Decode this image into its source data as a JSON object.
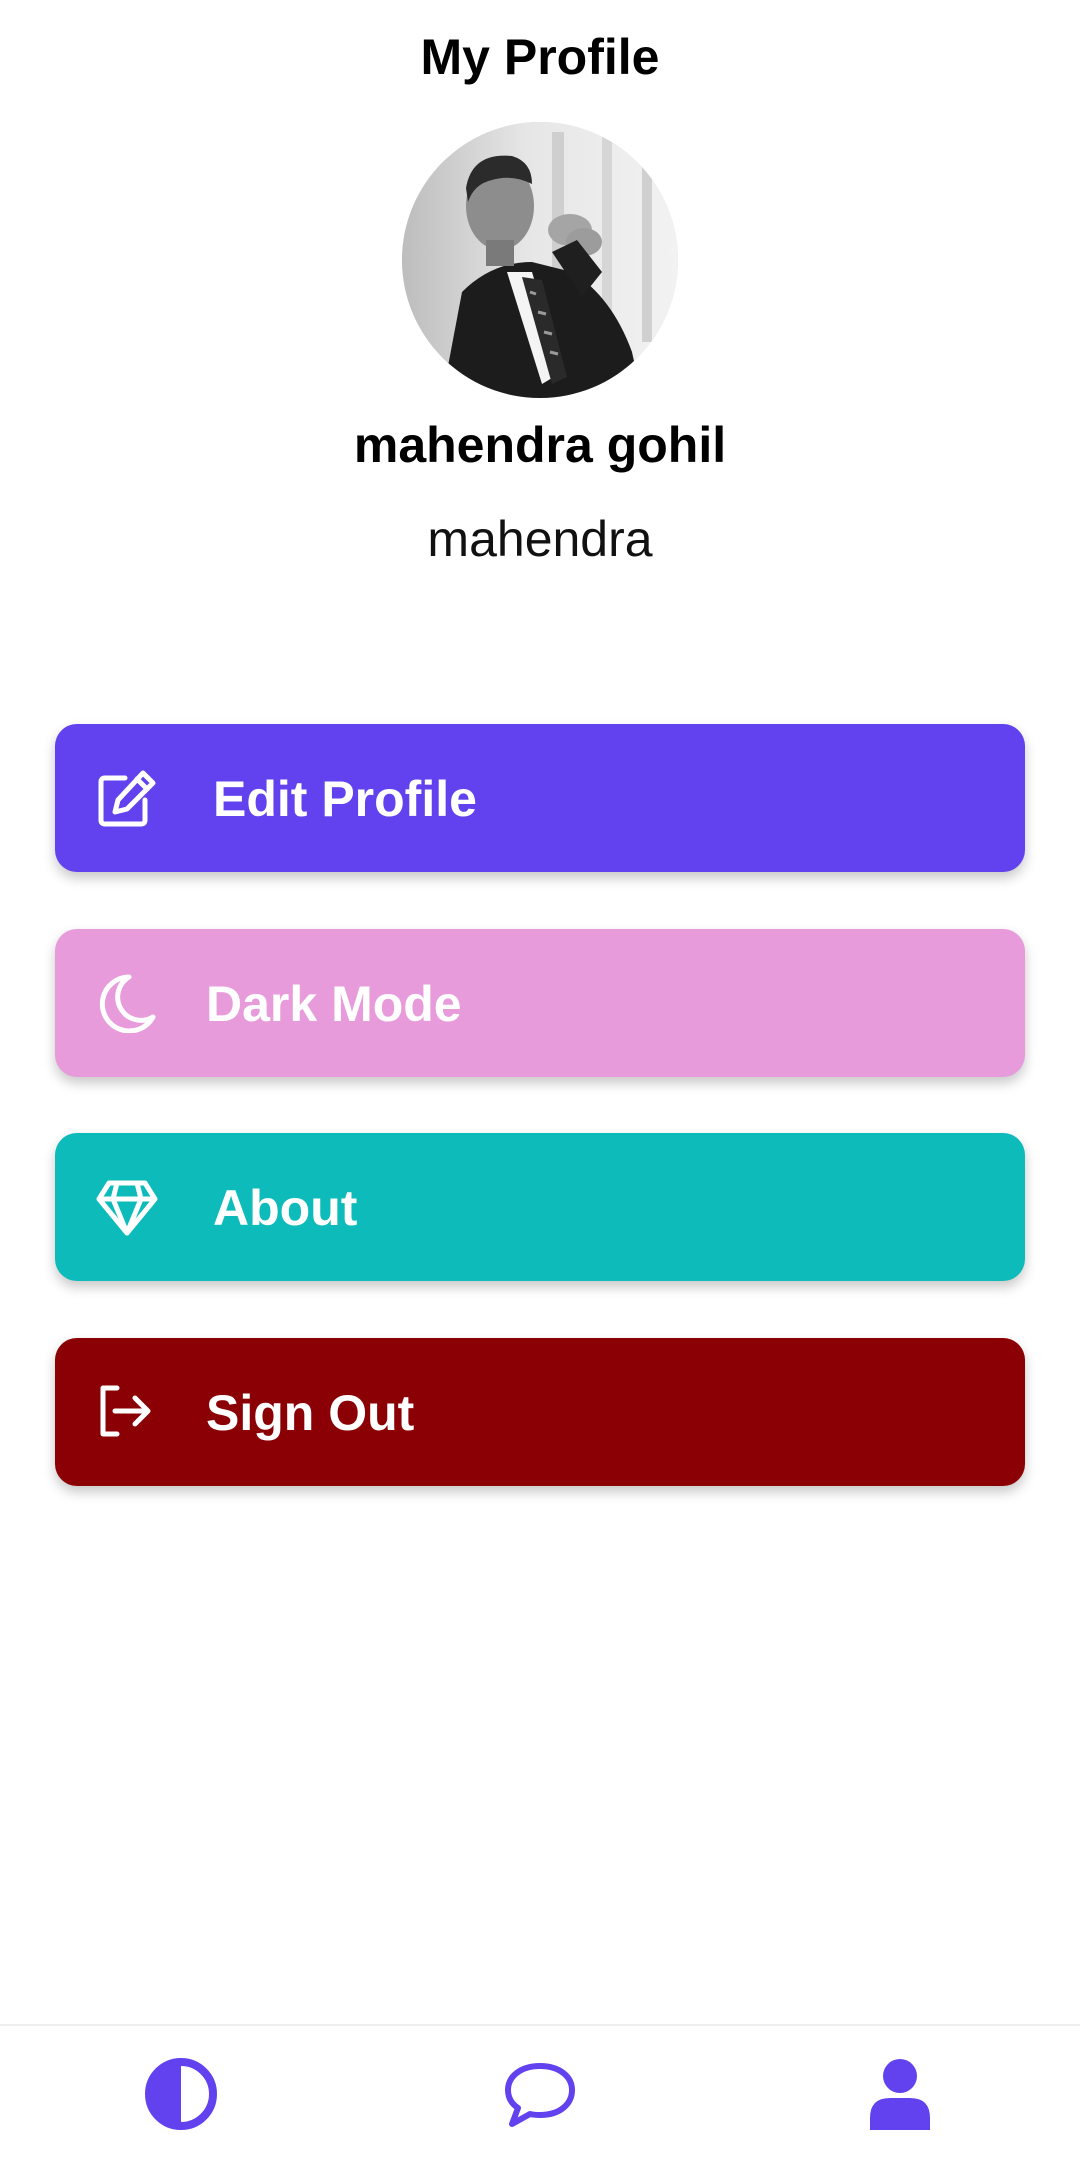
{
  "header": {
    "title": "My Profile"
  },
  "profile": {
    "avatar_icon": "profile-photo",
    "display_name": "mahendra gohil",
    "username": "mahendra"
  },
  "menu": {
    "edit_profile": {
      "label": "Edit Profile",
      "icon": "edit-icon",
      "color": "#6242EE"
    },
    "dark_mode": {
      "label": "Dark Mode",
      "icon": "moon-icon",
      "color": "#E89BDA"
    },
    "about": {
      "label": "About",
      "icon": "diamond-icon",
      "color": "#0DBBBA"
    },
    "sign_out": {
      "label": "Sign Out",
      "icon": "sign-out-icon",
      "color": "#8A0004"
    }
  },
  "bottom_nav": {
    "accent_color": "#6242EE",
    "items": [
      {
        "icon": "theme-toggle-icon"
      },
      {
        "icon": "chat-icon"
      },
      {
        "icon": "user-icon"
      }
    ]
  }
}
